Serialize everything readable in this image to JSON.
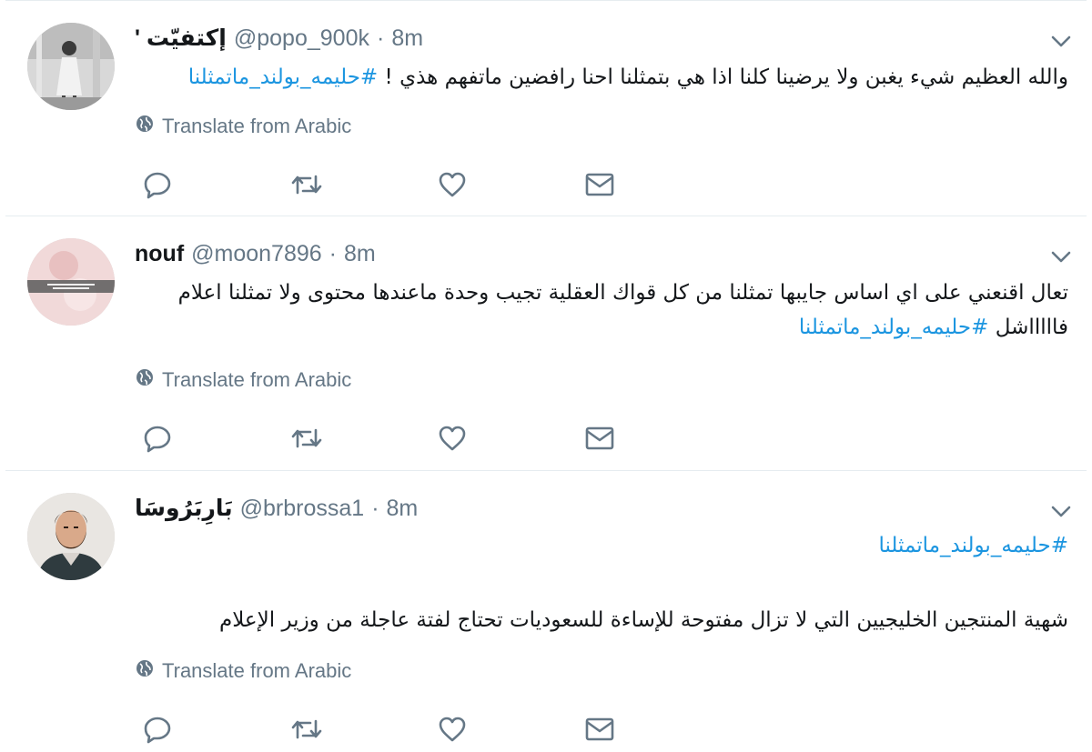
{
  "translate_label": "Translate from Arabic",
  "colors": {
    "link": "#1b95e0",
    "muted": "#657786",
    "text": "#14171a",
    "border": "#e6ecf0"
  },
  "tweets": [
    {
      "name": "' إكتفيّت",
      "handle": "@popo_900k",
      "separator": "·",
      "time": "8m",
      "body": {
        "line1_text": "والله العظيم شيء يغبن ولا يرضينا كلنا اذا هي بتمثلنا احنا رافضين ماتفهم هذي !",
        "line1_hashtag": "#حليمه_بولند_ماتمثلنا"
      },
      "avatar_icon": "woman-standing-photo"
    },
    {
      "name": "nouf",
      "handle": "@moon7896",
      "separator": "·",
      "time": "8m",
      "body": {
        "line1_text": "تعال اقنعني على اي اساس جايبها تمثلنا من كل قواك العقلية تجيب وحدة ماعندها محتوى ولا تمثلنا اعلام",
        "line2_text": "فاااااشل",
        "line2_hashtag": "#حليمه_بولند_ماتمثلنا"
      },
      "avatar_icon": "pink-photo"
    },
    {
      "name": "بَارِبَرُوسَا",
      "handle": "@brbrossa1",
      "separator": "·",
      "time": "8m",
      "body": {
        "line1_hashtag": "#حليمه_بولند_ماتمثلنا",
        "line2_text": "شهية المنتجين الخليجيين التي لا تزال مفتوحة للإساءة للسعوديات تحتاج لفتة عاجلة من وزير الإعلام"
      },
      "avatar_icon": "bearded-man-photo"
    }
  ]
}
